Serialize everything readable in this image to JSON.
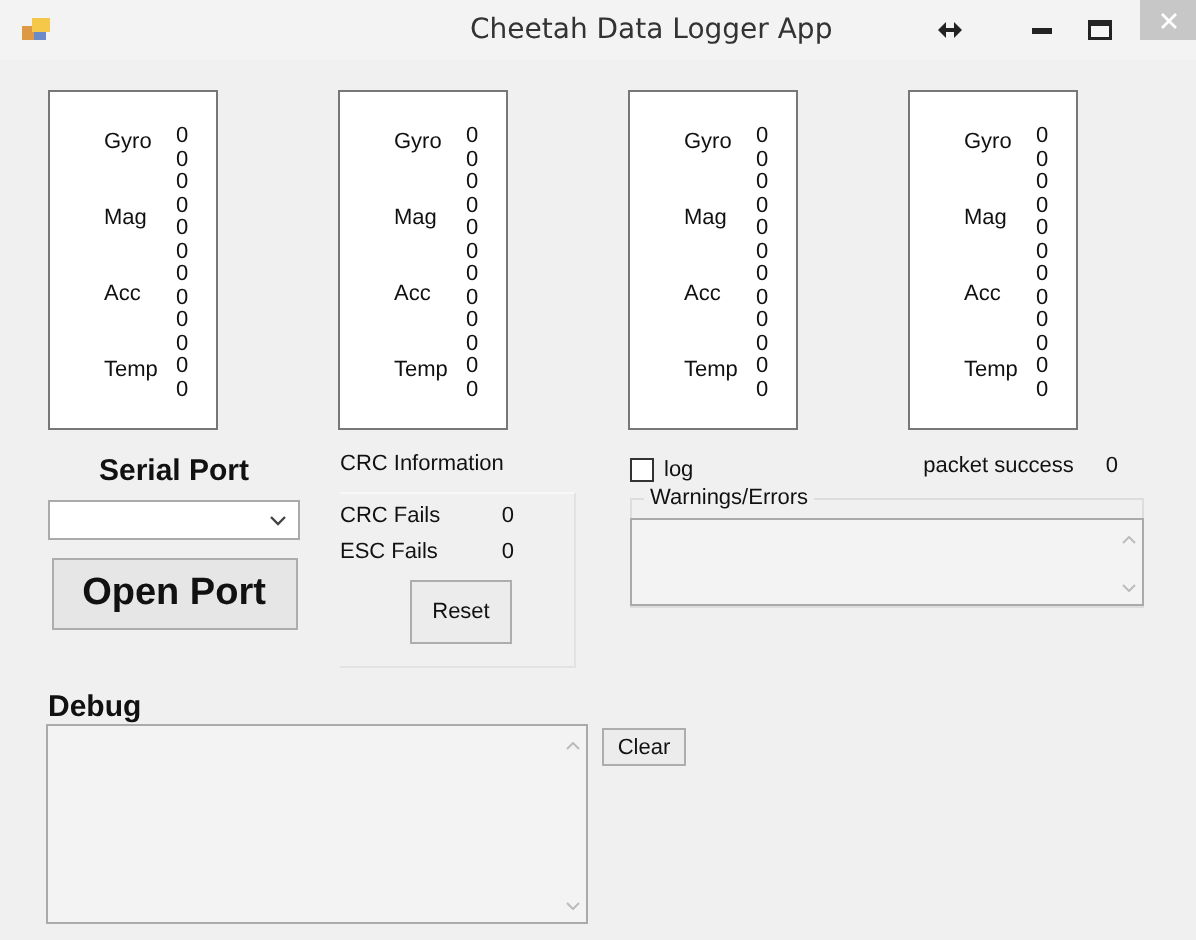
{
  "window": {
    "title": "Cheetah Data Logger App"
  },
  "sensor_panels": [
    {
      "labels": [
        "Gyro",
        "Mag",
        "Acc",
        "Temp"
      ],
      "values": [
        "0",
        "0",
        "0",
        "0",
        "0",
        "0",
        "0",
        "0",
        "0",
        "0",
        "0",
        "0"
      ]
    },
    {
      "labels": [
        "Gyro",
        "Mag",
        "Acc",
        "Temp"
      ],
      "values": [
        "0",
        "0",
        "0",
        "0",
        "0",
        "0",
        "0",
        "0",
        "0",
        "0",
        "0",
        "0"
      ]
    },
    {
      "labels": [
        "Gyro",
        "Mag",
        "Acc",
        "Temp"
      ],
      "values": [
        "0",
        "0",
        "0",
        "0",
        "0",
        "0",
        "0",
        "0",
        "0",
        "0",
        "0",
        "0"
      ]
    },
    {
      "labels": [
        "Gyro",
        "Mag",
        "Acc",
        "Temp"
      ],
      "values": [
        "0",
        "0",
        "0",
        "0",
        "0",
        "0",
        "0",
        "0",
        "0",
        "0",
        "0",
        "0"
      ]
    }
  ],
  "serial_port": {
    "heading": "Serial Port",
    "open_button": "Open Port"
  },
  "crc": {
    "heading": "CRC Information",
    "rows": [
      {
        "label": "CRC Fails",
        "value": "0"
      },
      {
        "label": "ESC Fails",
        "value": "0"
      }
    ],
    "reset_button": "Reset"
  },
  "log": {
    "label": "log",
    "checked": false
  },
  "packet_success": {
    "label": "packet success",
    "value": "0"
  },
  "warnings": {
    "title": "Warnings/Errors"
  },
  "debug": {
    "heading": "Debug",
    "clear_button": "Clear"
  }
}
